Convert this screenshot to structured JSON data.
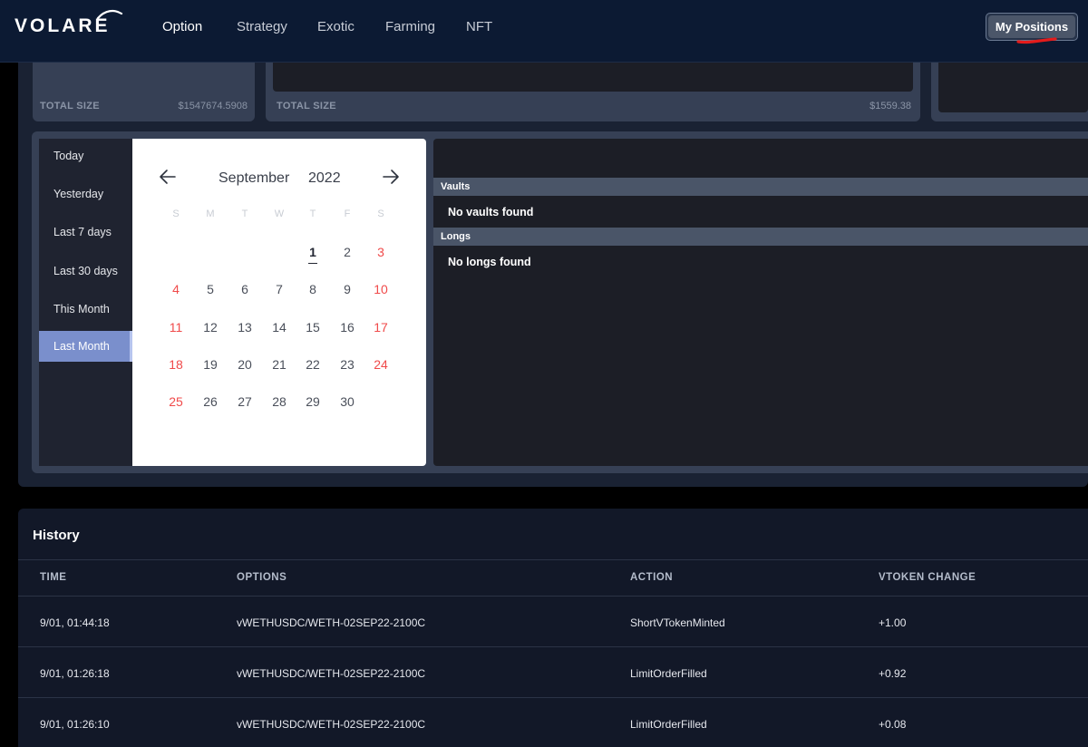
{
  "header": {
    "logo_text": "VOLARE",
    "nav": [
      "Option",
      "Strategy",
      "Exotic",
      "Farming",
      "NFT"
    ],
    "my_positions_label": "My Positions"
  },
  "summary": {
    "card1": {
      "label": "TOTAL SIZE",
      "value": "$1547674.5908"
    },
    "card2": {
      "label": "TOTAL SIZE",
      "value": "$1559.38"
    }
  },
  "date_ranges": {
    "items": [
      "Today",
      "Yesterday",
      "Last 7 days",
      "Last 30 days",
      "This Month",
      "Last Month"
    ],
    "selected": "Last Month"
  },
  "calendar": {
    "month": "September",
    "year": "2022",
    "weekdays": [
      "S",
      "M",
      "T",
      "W",
      "T",
      "F",
      "S"
    ],
    "days": [
      "1",
      "2",
      "3",
      "4",
      "5",
      "6",
      "7",
      "8",
      "9",
      "10",
      "11",
      "12",
      "13",
      "14",
      "15",
      "16",
      "17",
      "18",
      "19",
      "20",
      "21",
      "22",
      "23",
      "24",
      "25",
      "26",
      "27",
      "28",
      "29",
      "30"
    ],
    "today": "1"
  },
  "positions": {
    "vaults_header": "Vaults",
    "vaults_empty": "No vaults found",
    "longs_header": "Longs",
    "longs_empty": "No longs found"
  },
  "history": {
    "title": "History",
    "columns": [
      "TIME",
      "OPTIONS",
      "ACTION",
      "VTOKEN CHANGE"
    ],
    "rows": [
      {
        "time": "9/01, 01:44:18",
        "option": "vWETHUSDC/WETH-02SEP22-2100C",
        "action": "ShortVTokenMinted",
        "change": "+1.00"
      },
      {
        "time": "9/01, 01:26:18",
        "option": "vWETHUSDC/WETH-02SEP22-2100C",
        "action": "LimitOrderFilled",
        "change": "+0.92"
      },
      {
        "time": "9/01, 01:26:10",
        "option": "vWETHUSDC/WETH-02SEP22-2100C",
        "action": "LimitOrderFilled",
        "change": "+0.08"
      }
    ]
  },
  "colors": {
    "nav_bg": "#0c1a33",
    "accent_selected": "#7a8fcc",
    "weekend_red": "#f04a4a",
    "annotation_red": "#e41b1b"
  }
}
